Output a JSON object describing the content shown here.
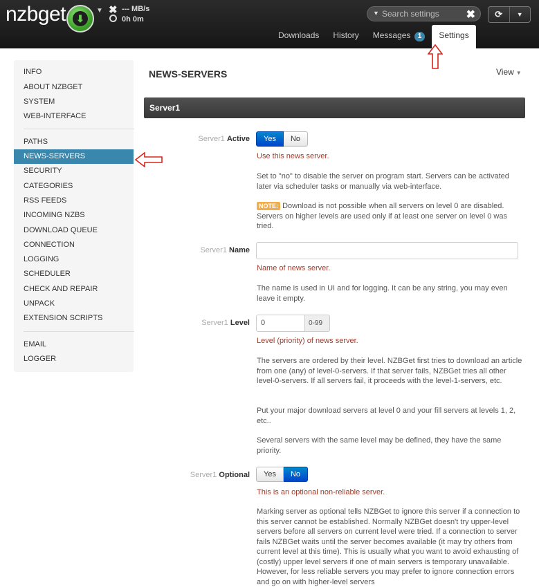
{
  "navbar": {
    "logo": "nzbget",
    "speed": "--- MB/s",
    "time": "0h 0m",
    "search_placeholder": "Search settings",
    "tabs": [
      {
        "label": "Downloads"
      },
      {
        "label": "History"
      },
      {
        "label": "Messages",
        "count": "1"
      },
      {
        "label": "Settings",
        "active": true
      }
    ]
  },
  "sidebar": {
    "groups": [
      [
        "INFO",
        "ABOUT NZBGET",
        "SYSTEM",
        "WEB-INTERFACE"
      ],
      [
        "PATHS",
        "NEWS-SERVERS",
        "SECURITY",
        "CATEGORIES",
        "RSS FEEDS",
        "INCOMING NZBS",
        "DOWNLOAD QUEUE",
        "CONNECTION",
        "LOGGING",
        "SCHEDULER",
        "CHECK AND REPAIR",
        "UNPACK",
        "EXTENSION SCRIPTS"
      ],
      [
        "EMAIL",
        "LOGGER"
      ]
    ],
    "active": "NEWS-SERVERS"
  },
  "main": {
    "title": "NEWS-SERVERS",
    "view_label": "View",
    "server_header": "Server1",
    "active": {
      "prefix": "Server1",
      "name": "Active",
      "yes": "Yes",
      "no": "No",
      "short": "Use this news server.",
      "desc": "Set to \"no\" to disable the server on program start. Servers can be activated later via scheduler tasks or manually via web-interface.",
      "note_tag": "NOTE:",
      "note": "Download is not possible when all servers on level 0 are disabled. Servers on higher levels are used only if at least one server on level 0 was tried."
    },
    "name_field": {
      "prefix": "Server1",
      "name": "Name",
      "value": "",
      "short": "Name of news server.",
      "desc": "The name is used in UI and for logging. It can be any string, you may even leave it empty."
    },
    "level": {
      "prefix": "Server1",
      "name": "Level",
      "value": "0",
      "range": "0-99",
      "short": "Level (priority) of news server.",
      "desc1": "The servers are ordered by their level. NZBGet first tries to download an article from one (any) of level-0-servers. If that server fails, NZBGet tries all other level-0-servers. If all servers fail, it proceeds with the level-1-servers, etc.",
      "desc2": "Put your major download servers at level 0 and your fill servers at levels 1, 2, etc..",
      "desc3": "Several servers with the same level may be defined, they have the same priority."
    },
    "optional": {
      "prefix": "Server1",
      "name": "Optional",
      "yes": "Yes",
      "no": "No",
      "short": "This is an optional non-reliable server.",
      "desc": "Marking server as optional tells NZBGet to ignore this server if a connection to this server cannot be established. Normally NZBGet doesn't try upper-level servers before all servers on current level were tried. If a connection to server fails NZBGet waits until the server becomes available (it may try others from current level at this time). This is usually what you want to avoid exhausting of (costly) upper level servers if one of main servers is temporary unavailable. However, for less reliable servers you may prefer to ignore connection errors and go on with higher-level servers"
    }
  },
  "colors": {
    "accent": "#3a87ad",
    "button_on": "#0055cc",
    "help_red": "#a13c2c",
    "annotation": "#d9261c"
  }
}
